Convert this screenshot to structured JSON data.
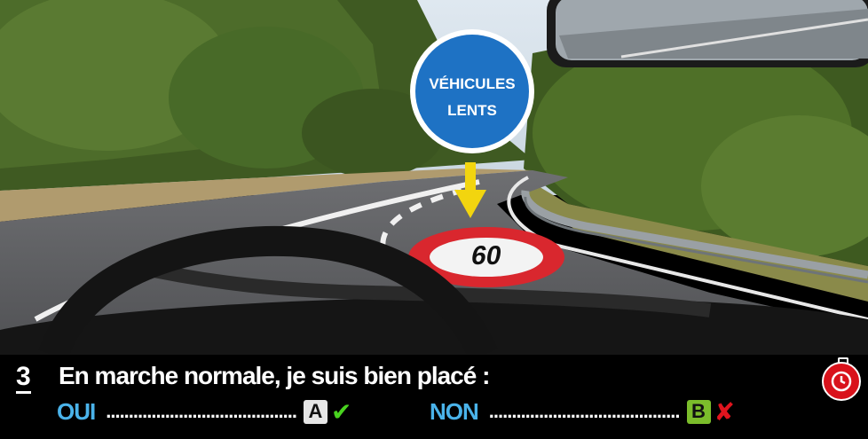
{
  "sign": {
    "line1": "VÉHICULES",
    "line2": "LENTS"
  },
  "road_marking": {
    "speed": "60"
  },
  "question": {
    "number": "3",
    "text": "En marche normale, je suis bien placé :",
    "answers": [
      {
        "label": "OUI",
        "dots": "..........................................",
        "letter": "A",
        "mark": "✔"
      },
      {
        "label": "NON",
        "dots": "..........................................",
        "letter": "B",
        "mark": "✘"
      }
    ]
  },
  "colors": {
    "sign_blue": "#1e72c4",
    "answer_label": "#4ab3ea",
    "letter_a_bg": "#e6e6e6",
    "letter_b_bg": "#7bbd2b",
    "check": "#49d31f",
    "cross": "#e0141e",
    "timer": "#d9121b"
  },
  "icons": {
    "timer": "stopwatch-icon",
    "correct": "check-icon",
    "wrong": "cross-icon"
  }
}
